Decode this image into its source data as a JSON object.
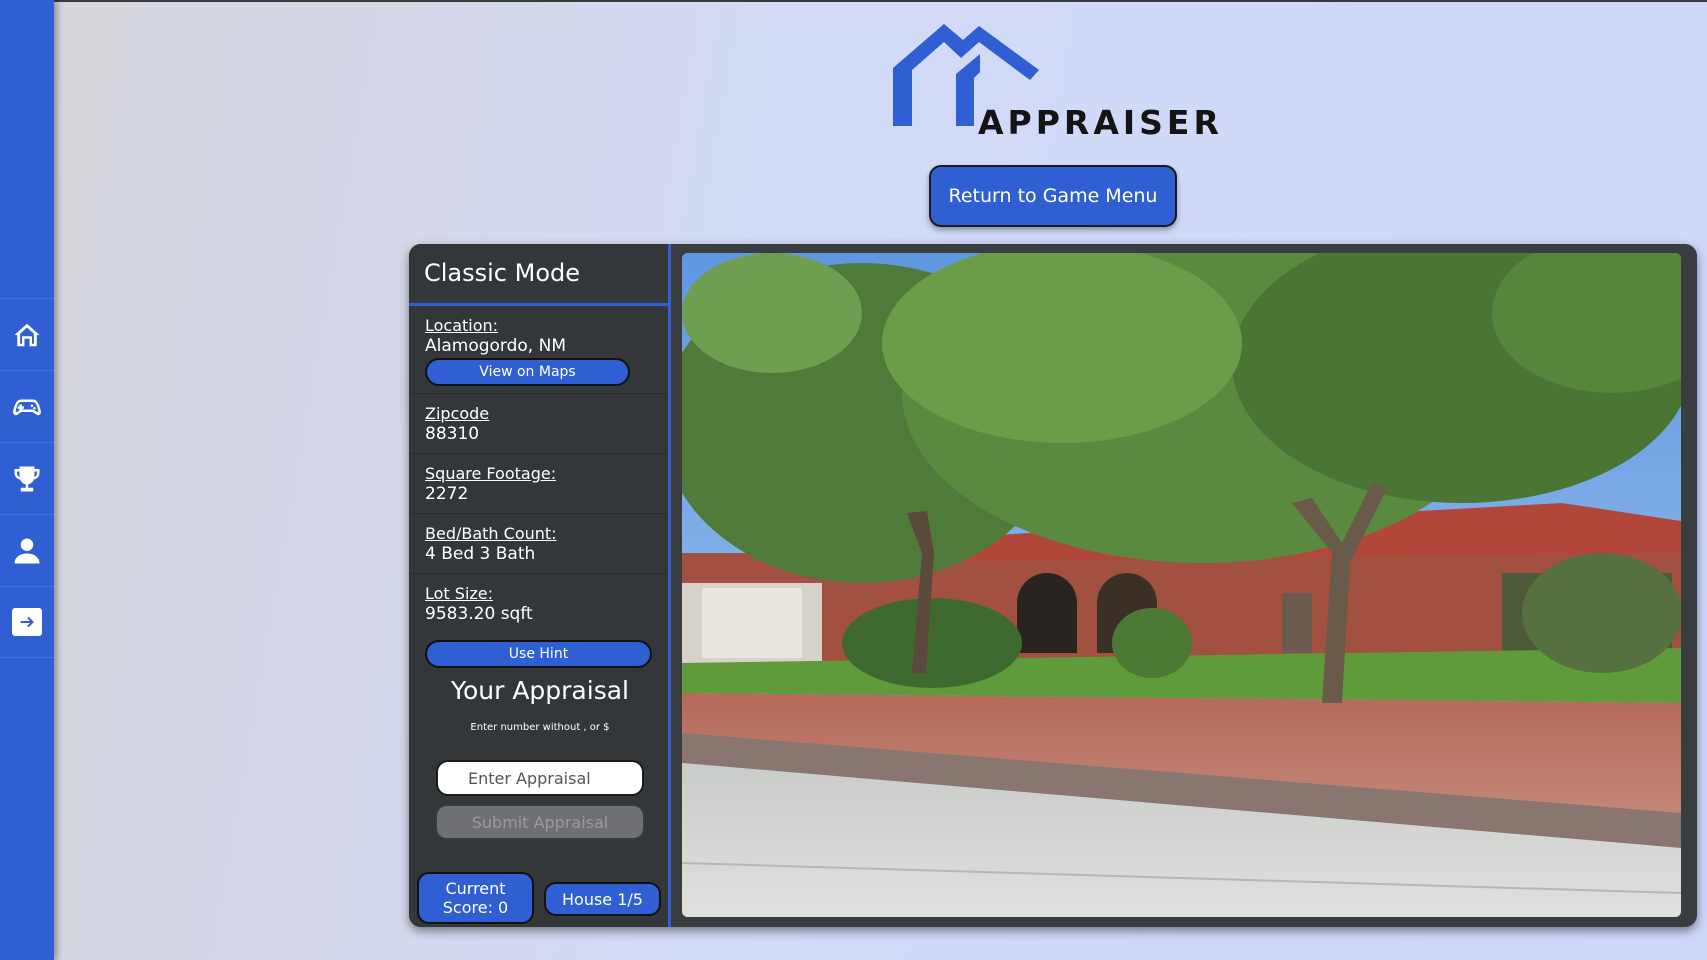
{
  "app": {
    "logo_text": "APPRAISER",
    "accent_color": "#2f5fd3"
  },
  "sidebar": {
    "items": [
      {
        "icon": "home-icon"
      },
      {
        "icon": "gamepad-icon"
      },
      {
        "icon": "trophy-icon"
      },
      {
        "icon": "user-icon"
      },
      {
        "icon": "logout-arrow-icon"
      }
    ]
  },
  "header": {
    "return_label": "Return to Game Menu"
  },
  "game": {
    "mode_title": "Classic Mode",
    "location_label": "Location:",
    "location_value": "Alamogordo, NM",
    "maps_label": "View on Maps",
    "zipcode_label": "Zipcode",
    "zipcode_value": "88310",
    "sqft_label": "Square Footage:",
    "sqft_value": "2272",
    "bedbath_label": "Bed/Bath Count:",
    "bedbath_value": "4 Bed 3 Bath",
    "lot_label": "Lot Size:",
    "lot_value": "9583.20 sqft",
    "hint_label": "Use Hint",
    "appraisal_title": "Your Appraisal",
    "appraisal_note": "Enter number without , or $",
    "appraisal_placeholder": "Enter Appraisal",
    "submit_label": "Submit Appraisal",
    "score_line1": "Current",
    "score_line2": "Score: 0",
    "house_counter": "House 1/5"
  }
}
